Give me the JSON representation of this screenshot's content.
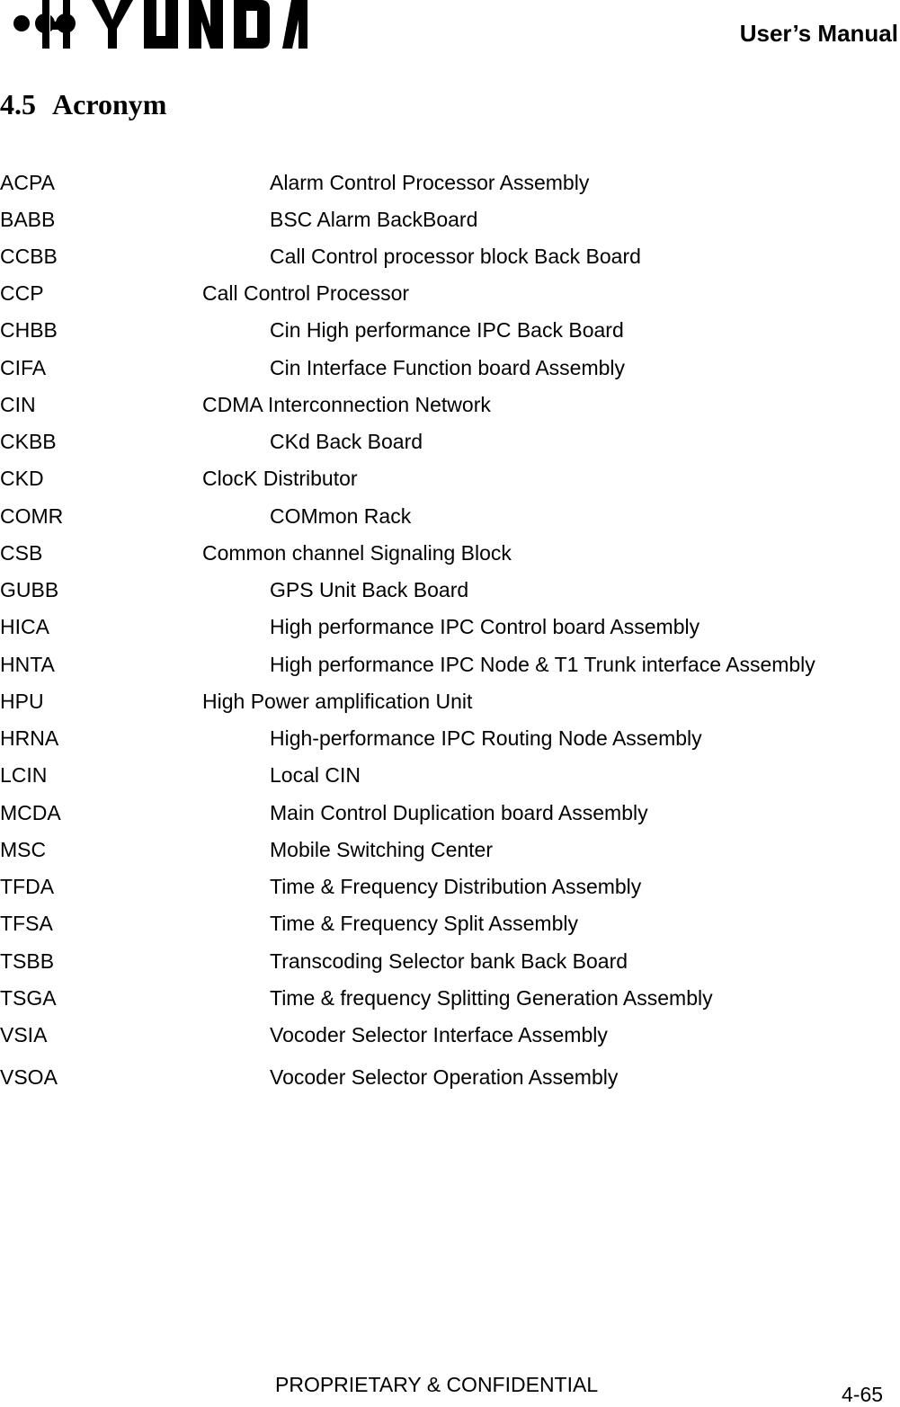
{
  "header": {
    "brand": "HYUNDAI",
    "logo_icon": "hyundai-logo",
    "title": "User’s Manual"
  },
  "section": {
    "number": "4.5",
    "title": "Acronym"
  },
  "acronyms": [
    {
      "abbr": "ACPA",
      "definition": "Alarm Control Processor Assembly",
      "indent": "long"
    },
    {
      "abbr": "BABB",
      "definition": "BSC Alarm BackBoard",
      "indent": "long"
    },
    {
      "abbr": "CCBB",
      "definition": "Call Control processor block Back Board",
      "indent": "long"
    },
    {
      "abbr": "CCP",
      "definition": "Call Control Processor",
      "indent": "short"
    },
    {
      "abbr": "CHBB",
      "definition": "Cin High performance IPC Back Board",
      "indent": "long"
    },
    {
      "abbr": "CIFA",
      "definition": "Cin Interface Function board Assembly",
      "indent": "long"
    },
    {
      "abbr": "CIN",
      "definition": "CDMA Interconnection Network",
      "indent": "short"
    },
    {
      "abbr": "CKBB",
      "definition": "CKd Back Board",
      "indent": "long"
    },
    {
      "abbr": "CKD",
      "definition": "ClocK Distributor",
      "indent": "short"
    },
    {
      "abbr": "COMR",
      "definition": "COMmon Rack",
      "indent": "long"
    },
    {
      "abbr": "CSB",
      "definition": "Common channel Signaling Block",
      "indent": "short"
    },
    {
      "abbr": "GUBB",
      "definition": "GPS Unit Back Board",
      "indent": "long"
    },
    {
      "abbr": "HICA",
      "definition": "High performance IPC Control board Assembly",
      "indent": "long"
    },
    {
      "abbr": "HNTA",
      "definition": "High performance IPC Node & T1 Trunk interface Assembly",
      "indent": "long"
    },
    {
      "abbr": "HPU",
      "definition": "High Power amplification Unit",
      "indent": "short"
    },
    {
      "abbr": "HRNA",
      "definition": "High-performance IPC Routing Node Assembly",
      "indent": "long"
    },
    {
      "abbr": "LCIN",
      "definition": "Local CIN",
      "indent": "long"
    },
    {
      "abbr": "MCDA",
      "definition": "Main Control Duplication board Assembly",
      "indent": "long"
    },
    {
      "abbr": "MSC",
      "definition": "Mobile Switching Center",
      "indent": "long"
    },
    {
      "abbr": "TFDA",
      "definition": "Time & Frequency Distribution Assembly",
      "indent": "long"
    },
    {
      "abbr": "TFSA",
      "definition": "Time & Frequency Split Assembly",
      "indent": "long"
    },
    {
      "abbr": "TSBB",
      "definition": "Transcoding Selector bank Back Board",
      "indent": "long"
    },
    {
      "abbr": "TSGA",
      "definition": "Time & frequency Splitting Generation Assembly",
      "indent": "long"
    },
    {
      "abbr": "VSIA",
      "definition": "Vocoder Selector Interface Assembly",
      "indent": "long"
    },
    {
      "abbr": "VSOA",
      "definition": "Vocoder Selector Operation Assembly",
      "indent": "long"
    }
  ],
  "footer": {
    "notice": "PROPRIETARY & CONFIDENTIAL",
    "page": "4-65"
  }
}
